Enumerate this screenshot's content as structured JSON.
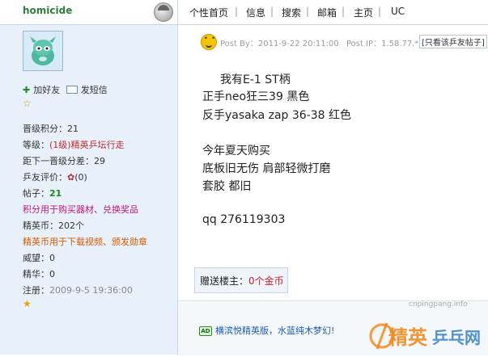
{
  "user": {
    "name": "homicide",
    "add_friend": "加好友",
    "send_message": "发短信",
    "info": [
      {
        "label": "晋级积分：",
        "value": "21",
        "cls": ""
      },
      {
        "label": "等级：",
        "value": "(1级)精英乒坛行走",
        "cls": "red"
      },
      {
        "label": "距下一晋级分差：",
        "value": "29",
        "cls": ""
      },
      {
        "label": "乒友评价：",
        "value": "(0)",
        "cls": ""
      },
      {
        "label": "帖子：",
        "value": "21",
        "cls": "green"
      },
      {
        "label": "",
        "value": "积分用于购买器材、兑换奖品",
        "cls": "magenta"
      },
      {
        "label": "精英币：",
        "value": "202个",
        "cls": ""
      },
      {
        "label": "",
        "value": "精英币用于下载视频、颁发勋章",
        "cls": "orange"
      },
      {
        "label": "威望：",
        "value": "0",
        "cls": ""
      },
      {
        "label": "精华：",
        "value": "0",
        "cls": ""
      },
      {
        "label": "注册：",
        "value": "2009-9-5 19:36:00",
        "cls": "gray"
      }
    ]
  },
  "nav": [
    "个性首页",
    "信息",
    "搜索",
    "邮箱",
    "主页",
    "UC"
  ],
  "post": {
    "post_by": "Post By：2011-9-22 20:11:00",
    "post_ip": "Post IP：1.58.77.*",
    "only_him": "只看该乒友帖子",
    "lines": [
      "我有E-1 ST柄",
      "正手neo狂三39 黑色",
      "反手yasaka zap 36-38 红色",
      "",
      "今年夏天购买",
      "底板旧无伤 肩部轻微打磨",
      "套胶 都旧",
      "",
      "qq 276119303"
    ]
  },
  "gift": {
    "prefix": "赠送楼主：",
    "amount": "0个金币"
  },
  "ad": {
    "badge": "AD",
    "text": "横滨悦精英版，水蓝纯木梦幻!"
  },
  "watermark": {
    "url": "cnpingpang.info",
    "text_left": "精英",
    "text_right": "乒乓网"
  }
}
